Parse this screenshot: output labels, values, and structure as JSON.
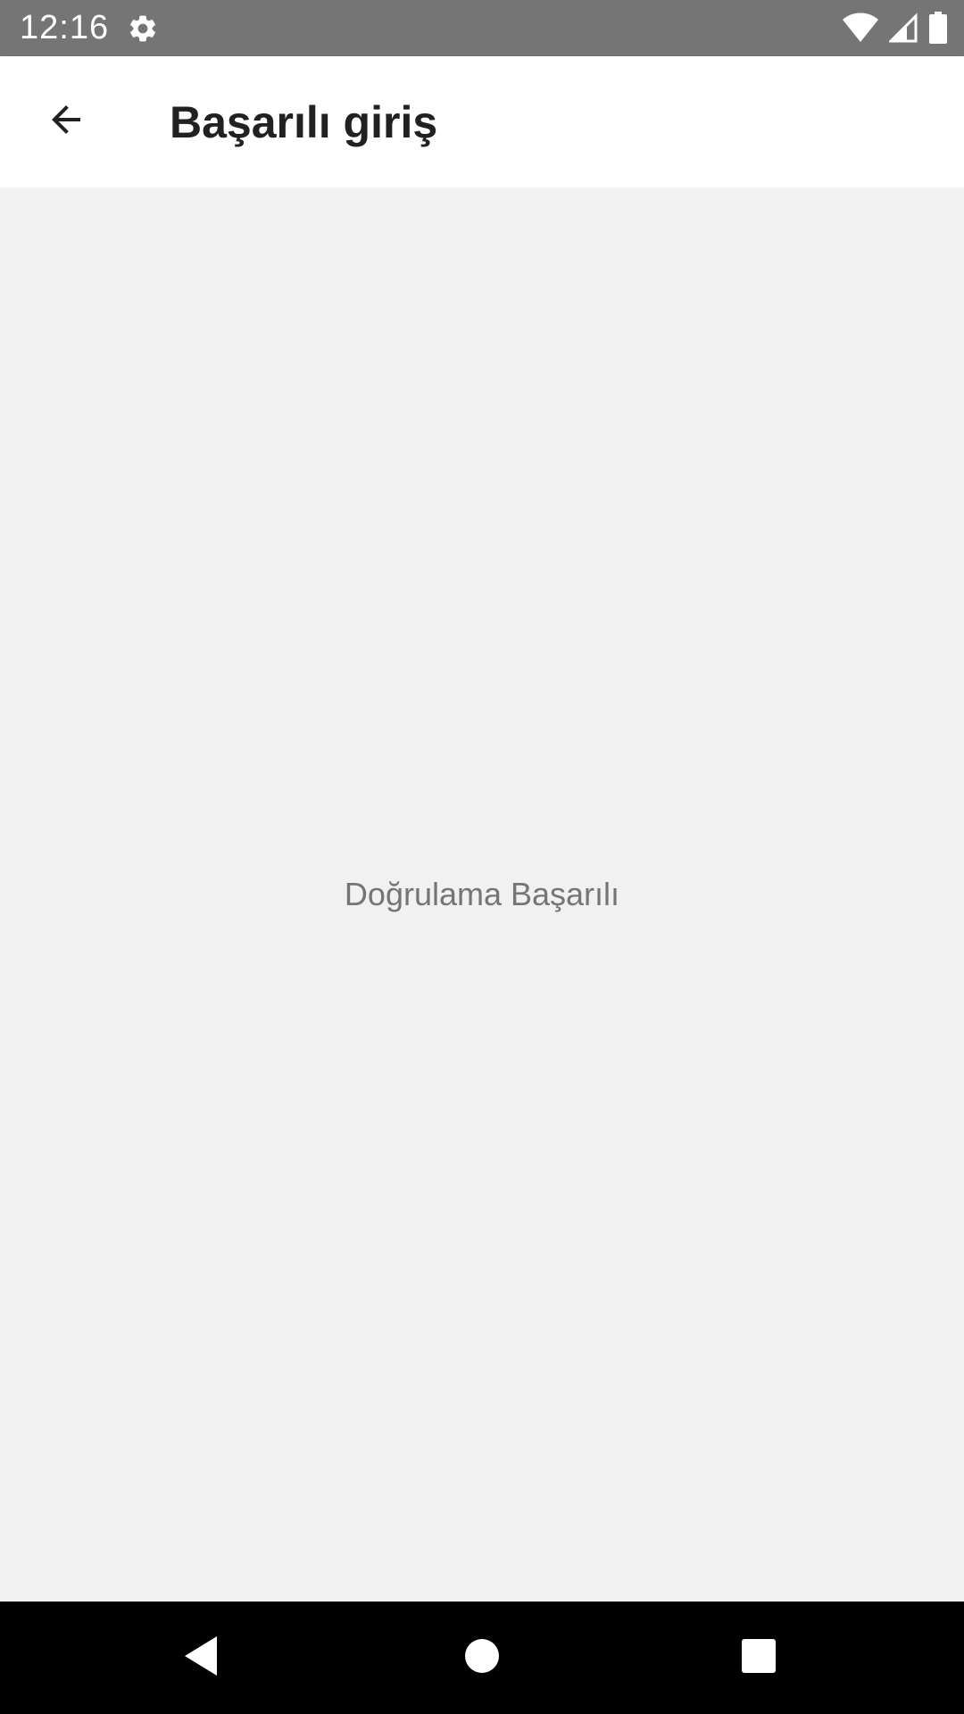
{
  "status_bar": {
    "time": "12:16",
    "icons": [
      "settings-icon",
      "wifi-icon",
      "signal-icon",
      "battery-icon"
    ],
    "background": "#757575"
  },
  "app_bar": {
    "title": "Başarılı giriş",
    "back_icon": "arrow-back-icon"
  },
  "main": {
    "message": "Doğrulama Başarılı"
  },
  "nav_bar": {
    "buttons": [
      "back-triangle-icon",
      "home-circle-icon",
      "recents-square-icon"
    ]
  },
  "colors": {
    "title_text": "#212121",
    "message_text": "#757575",
    "content_bg": "#f1f1f1",
    "app_bar_bg": "#ffffff",
    "nav_bar_bg": "#000000"
  }
}
